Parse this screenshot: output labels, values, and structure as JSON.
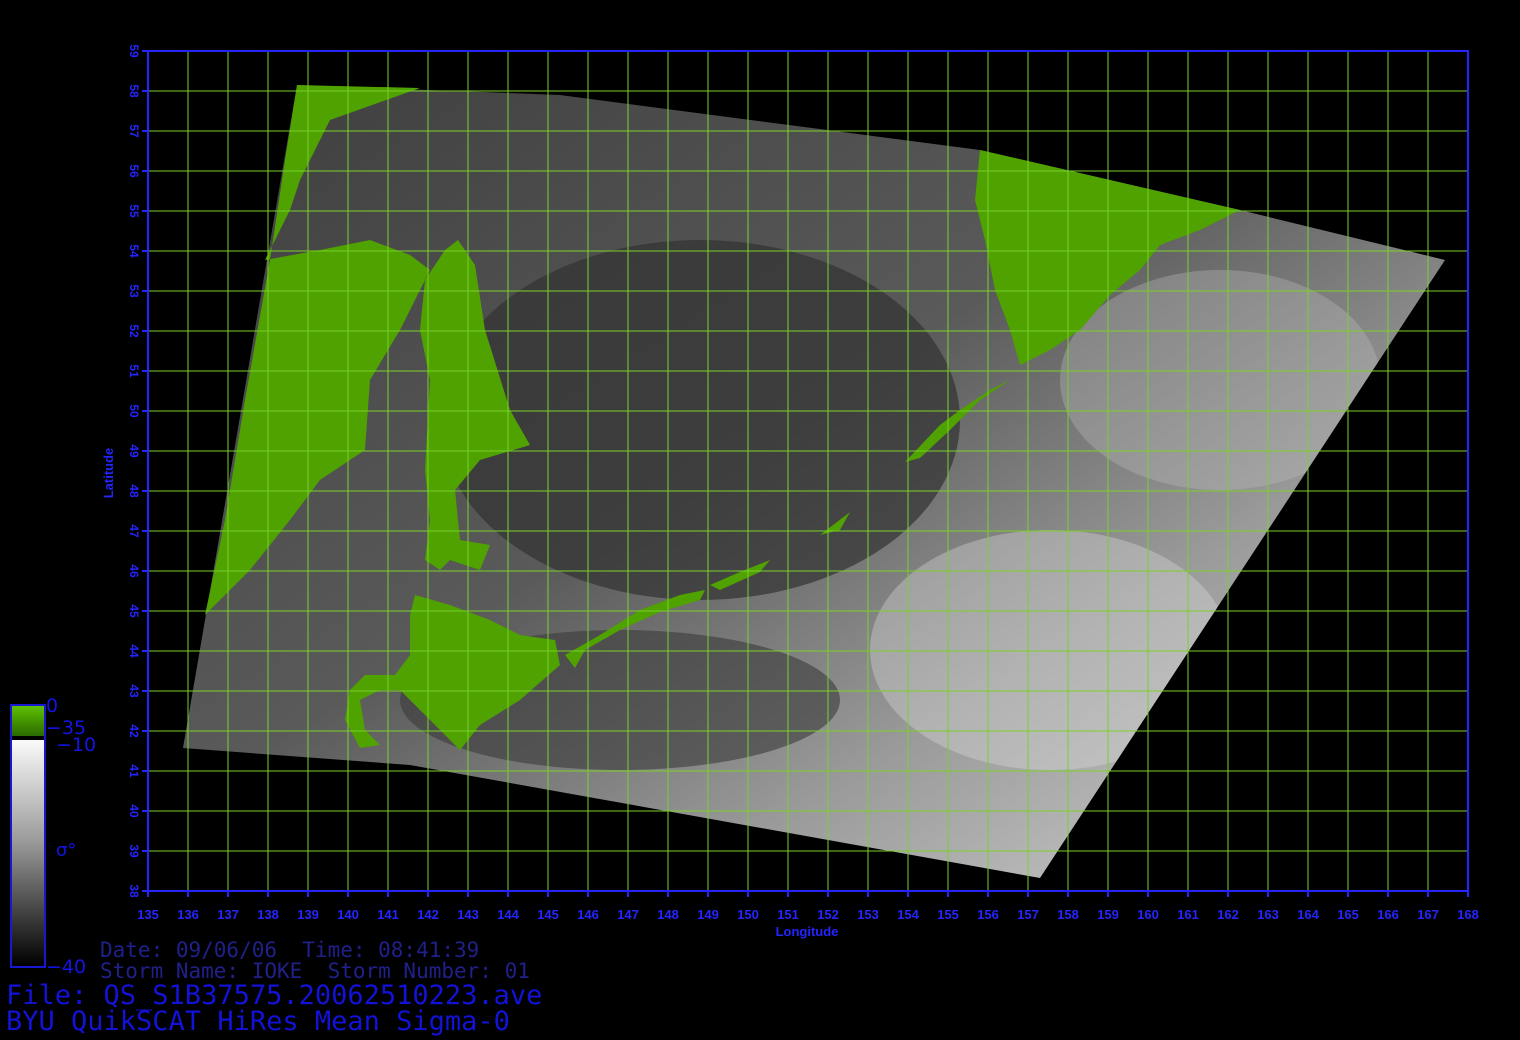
{
  "map": {
    "xlabel": "Longitude",
    "ylabel": "Latitude",
    "lon_range": [
      135,
      168
    ],
    "lat_range": [
      38,
      59
    ],
    "lon_ticks": [
      "135",
      "136",
      "137",
      "138",
      "139",
      "140",
      "141",
      "142",
      "143",
      "144",
      "145",
      "146",
      "147",
      "148",
      "149",
      "150",
      "151",
      "152",
      "153",
      "154",
      "155",
      "156",
      "157",
      "158",
      "159",
      "160",
      "161",
      "162",
      "163",
      "164",
      "165",
      "166",
      "167",
      "168"
    ],
    "lat_ticks": [
      "38",
      "39",
      "40",
      "41",
      "42",
      "43",
      "44",
      "45",
      "46",
      "47",
      "48",
      "49",
      "50",
      "51",
      "52",
      "53",
      "54",
      "55",
      "56",
      "57",
      "58",
      "59"
    ],
    "grid": true,
    "colors": {
      "grid": "#7ad12a",
      "axis": "#2424ff",
      "land": "#4fa200",
      "background": "#000000"
    }
  },
  "colorbar": {
    "label_0": "0",
    "label_35": "−35",
    "label_10": "−10",
    "label_40": "−40",
    "symbol": "σ°"
  },
  "info": {
    "line1": "Date: 09/06/06  Time: 08:41:39",
    "line2": "Storm Name: IOKE  Storm Number: 01",
    "line3": "File: QS_S1B37575.20062510223.ave",
    "line4": "BYU QuikSCAT HiRes Mean Sigma-0"
  }
}
